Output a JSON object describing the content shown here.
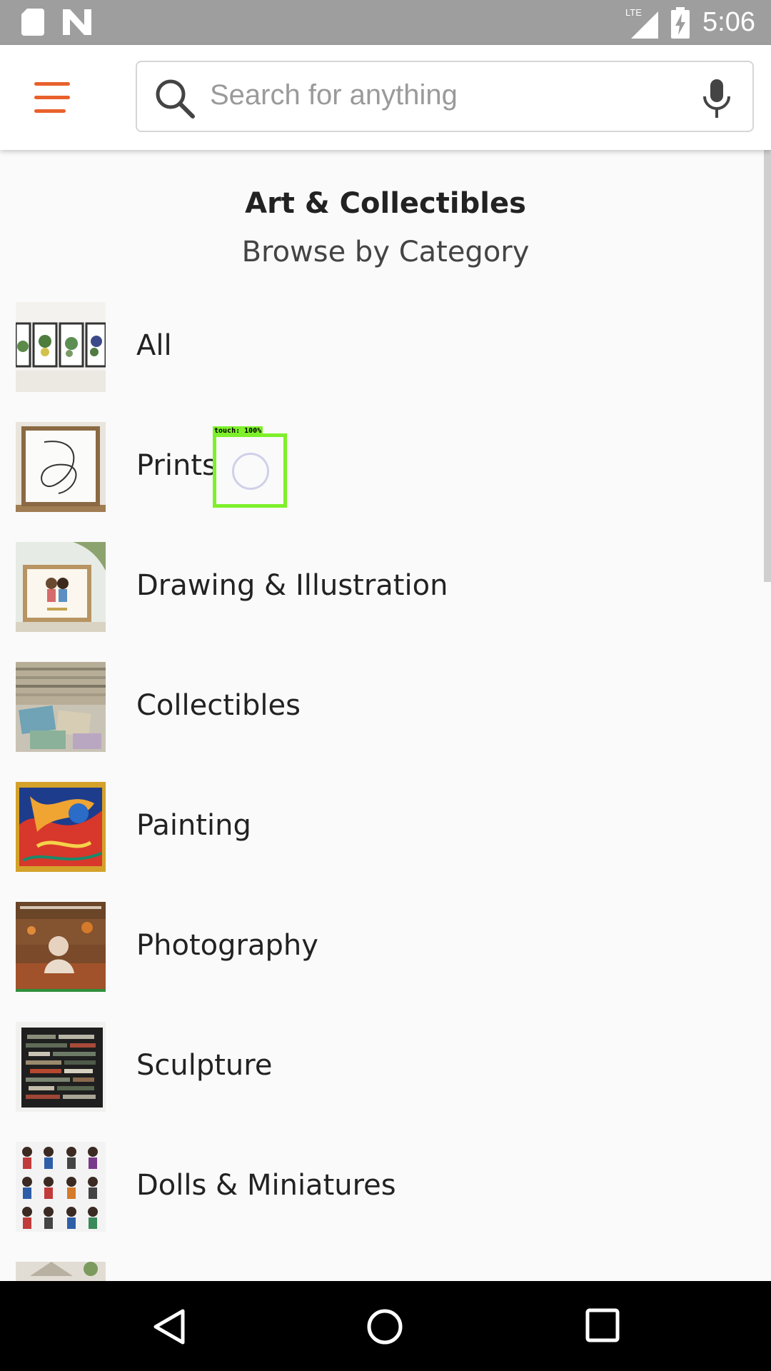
{
  "status_bar": {
    "time": "5:06",
    "network_label": "LTE",
    "icons": [
      "sd-card-icon",
      "n-notification-icon",
      "lte-signal-icon",
      "battery-charging-icon"
    ]
  },
  "app_bar": {
    "menu_icon": "hamburger-menu-icon",
    "search": {
      "placeholder": "Search for anything",
      "value": ""
    },
    "mic_icon": "microphone-icon",
    "accent_color": "#e8612c"
  },
  "header": {
    "title": "Art & Collectibles",
    "subtitle": "Browse by Category"
  },
  "categories": [
    {
      "label": "All"
    },
    {
      "label": "Prints"
    },
    {
      "label": "Drawing & Illustration"
    },
    {
      "label": "Collectibles"
    },
    {
      "label": "Painting"
    },
    {
      "label": "Photography"
    },
    {
      "label": "Sculpture"
    },
    {
      "label": "Dolls & Miniatures"
    }
  ],
  "touch_overlay": {
    "label": "touch: 100%"
  },
  "nav_bar": {
    "icons": [
      "back-icon",
      "home-icon",
      "recents-icon"
    ]
  }
}
